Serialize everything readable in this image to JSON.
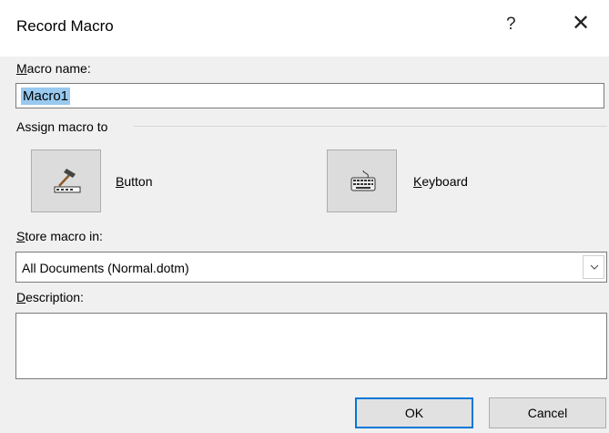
{
  "dialog": {
    "title": "Record Macro",
    "help_icon": "?",
    "close_icon": "✕"
  },
  "macro_name": {
    "label_accel": "M",
    "label_rest": "acro name:",
    "value": "Macro1"
  },
  "assign": {
    "label": "Assign macro to",
    "button_accel": "B",
    "button_rest": "utton",
    "keyboard_accel": "K",
    "keyboard_rest": "eyboard",
    "button_icon": "hammer-toolbar-icon",
    "keyboard_icon": "keyboard-icon"
  },
  "store": {
    "label_accel": "S",
    "label_rest": "tore macro in:",
    "value": "All Documents (Normal.dotm)"
  },
  "description": {
    "label_accel": "D",
    "label_rest": "escription:",
    "value": ""
  },
  "buttons": {
    "ok": "OK",
    "cancel": "Cancel"
  },
  "colors": {
    "selection": "#99c9ef",
    "focus_border": "#0078d7"
  }
}
